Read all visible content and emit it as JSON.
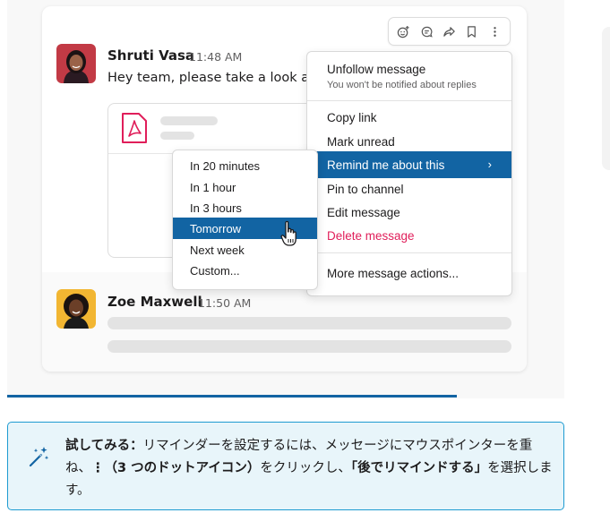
{
  "messages": [
    {
      "name": "Shruti Vasa",
      "time": "11:48 AM",
      "text": "Hey team, please take a look at the"
    },
    {
      "name": "Zoe Maxwell",
      "time": "11:50 AM"
    }
  ],
  "toolbar": {
    "icons": [
      "add-reaction-icon",
      "reply-in-thread-icon",
      "share-icon",
      "bookmark-icon",
      "more-actions-icon"
    ]
  },
  "context_menu": {
    "unfollow": {
      "label": "Unfollow message",
      "sub": "You won't be notified about replies"
    },
    "copy_link": "Copy link",
    "mark_unread": "Mark unread",
    "remind": "Remind me about this",
    "remind_chevron": "›",
    "pin": "Pin to channel",
    "edit": "Edit message",
    "delete": "Delete message",
    "more": "More message actions..."
  },
  "remind_submenu": {
    "items": [
      "In 20 minutes",
      "In 1 hour",
      "In 3 hours",
      "Tomorrow",
      "Next week",
      "Custom..."
    ],
    "highlighted": "Tomorrow"
  },
  "tip": {
    "lead": "試してみる：",
    "part1": "リマインダーを設定するには、メッセージにマウスポインターを重ね、",
    "dots": "⋮",
    "dots_label": "（3 つのドットアイコン）",
    "part2": "をクリックし、",
    "action": "「後でリマインドする」",
    "part3": "を選択します。"
  },
  "colors": {
    "accent": "#1264a3",
    "danger": "#e01e5a",
    "tip_background": "#e8f5fa",
    "tip_border": "#1d9bd1"
  }
}
